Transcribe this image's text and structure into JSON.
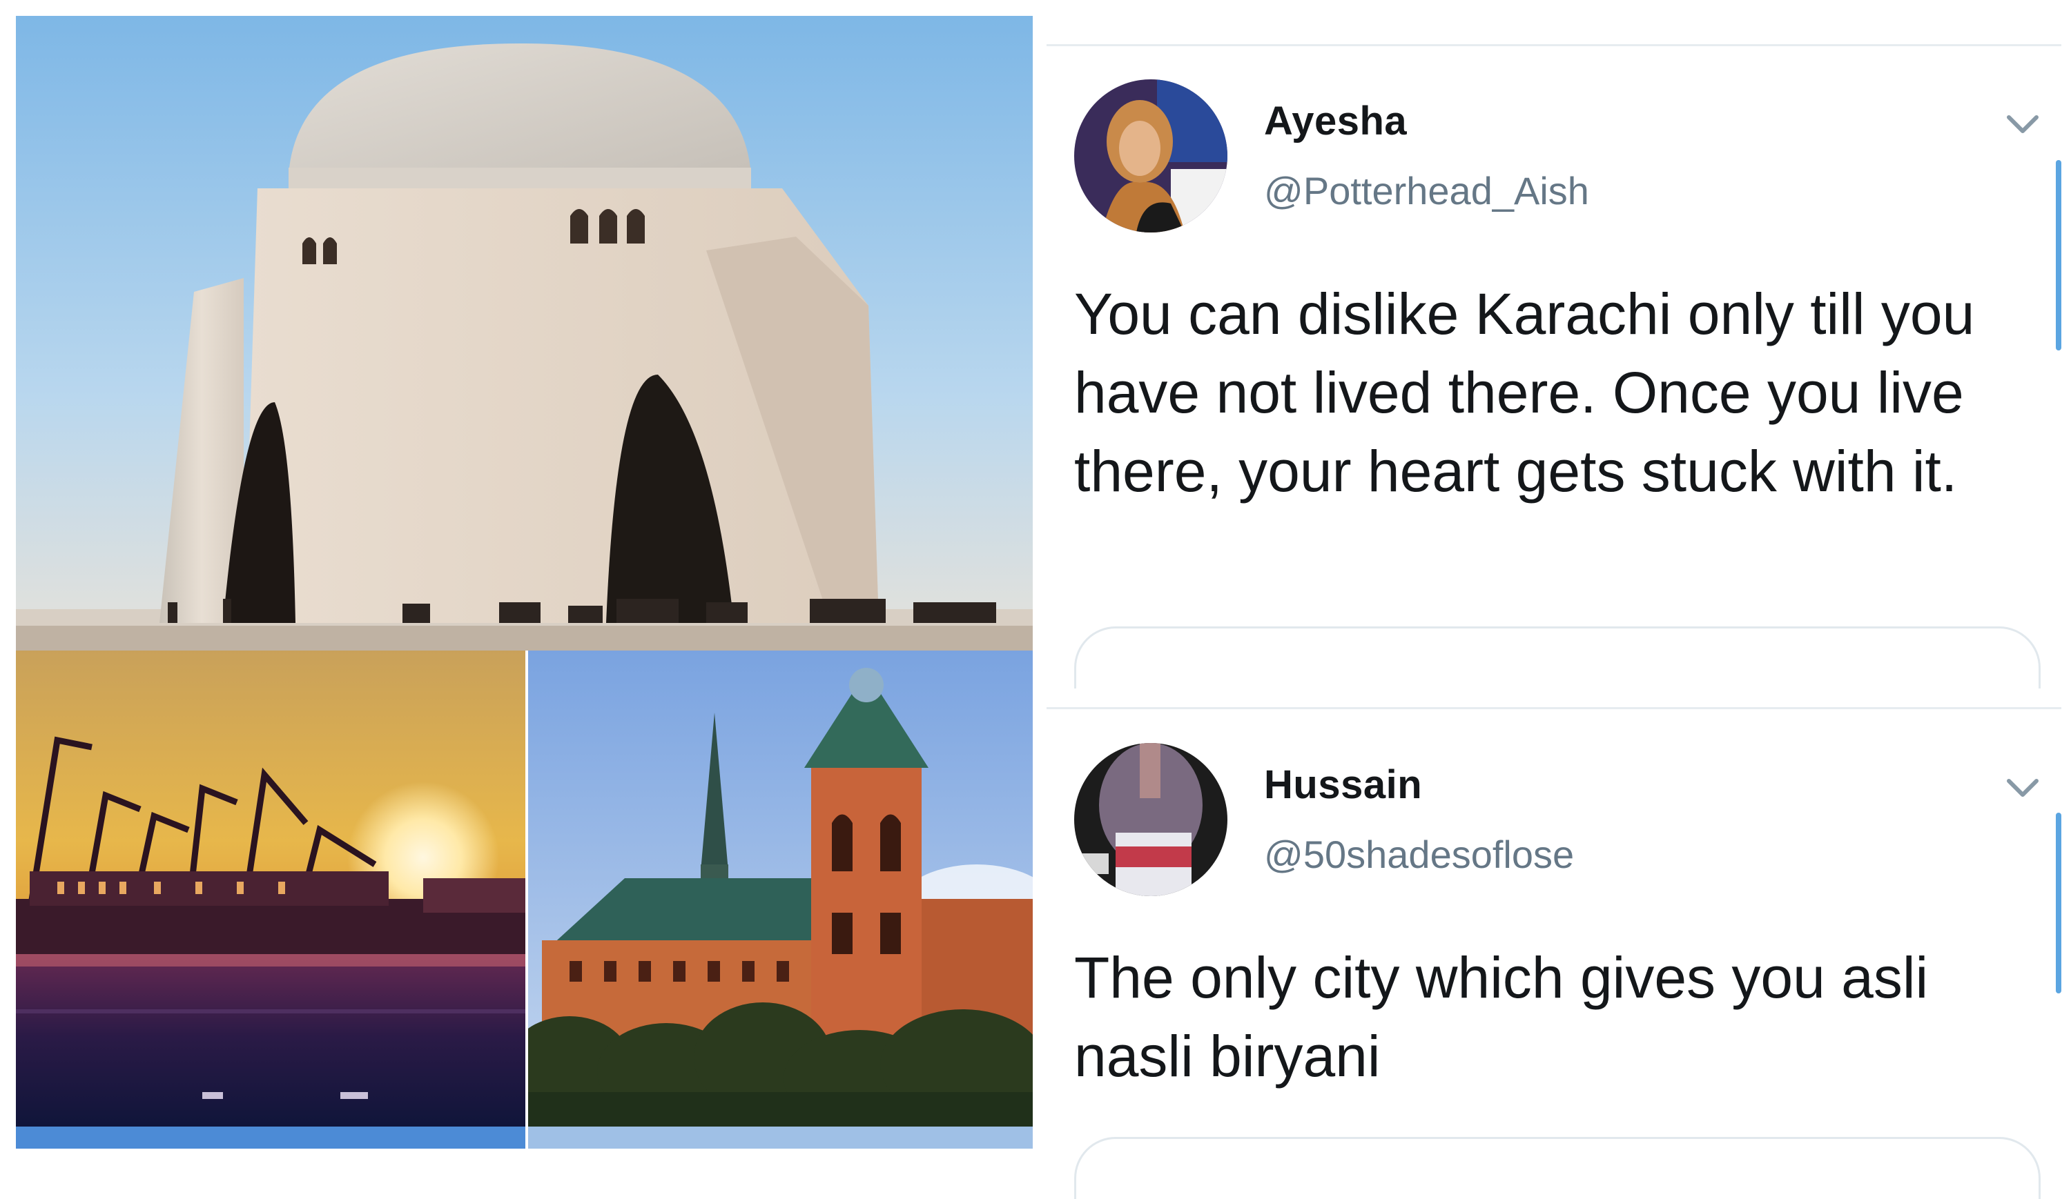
{
  "collage": {
    "photos": [
      "mausoleum",
      "port-sunset",
      "frere-hall"
    ]
  },
  "tweets": [
    {
      "name": "Ayesha",
      "handle": "@Potterhead_Aish",
      "text": "You can dislike Karachi only till you have not lived there. Once you live there, your heart gets stuck with it.",
      "avatar_icon": "avatar-photo",
      "menu_icon": "chevron-down-icon"
    },
    {
      "name": "Hussain",
      "handle": "@50shadesoflose",
      "text": "The only city which gives you asli nasli biryani",
      "avatar_icon": "avatar-photo",
      "menu_icon": "chevron-down-icon"
    }
  ],
  "colors": {
    "name": "#14171a",
    "handle": "#657786",
    "thread_bar": "#5ba5e1",
    "divider": "#e6ecf0"
  }
}
